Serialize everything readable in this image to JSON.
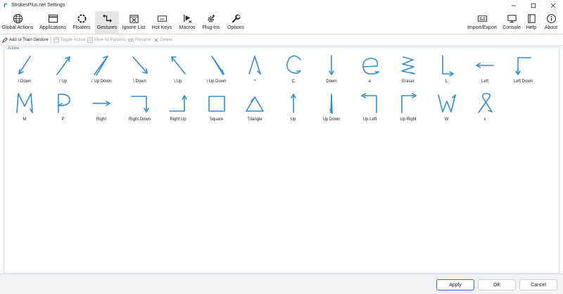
{
  "window": {
    "title": "StrokesPlus.net Settings"
  },
  "ribbon": [
    {
      "id": "global",
      "label": "Global Actions",
      "icon": "globe-icon"
    },
    {
      "id": "applications",
      "label": "Applications",
      "icon": "window-icon"
    },
    {
      "id": "floaters",
      "label": "Floaters",
      "icon": "floater-ring-icon"
    },
    {
      "id": "gestures",
      "label": "Gestures",
      "icon": "gesture-icon",
      "active": true
    },
    {
      "id": "ignore",
      "label": "Ignore List",
      "icon": "ignore-box-icon"
    },
    {
      "id": "hotkeys",
      "label": "Hot Keys",
      "icon": "keyboard-icon"
    },
    {
      "id": "macros",
      "label": "Macros",
      "icon": "macro-play-icon"
    },
    {
      "id": "plugins",
      "label": "Plug-ins",
      "icon": "plugin-gear-icon"
    },
    {
      "id": "options",
      "label": "Options",
      "icon": "wrench-icon"
    },
    {
      "id": "importexport",
      "label": "Import/Export",
      "icon": "import-export-icon"
    },
    {
      "id": "console",
      "label": "Console",
      "icon": "monitor-icon"
    },
    {
      "id": "help",
      "label": "Help",
      "icon": "help-book-icon"
    },
    {
      "id": "about",
      "label": "About",
      "icon": "info-icon"
    }
  ],
  "toolbar": {
    "add": "Add or Train Gesture",
    "toggle": "Toggle Active",
    "viewall": "View All Patterns",
    "rename": "Rename",
    "delete": "Delete"
  },
  "group": {
    "label": "Active"
  },
  "gestures": [
    {
      "label": "/ Down"
    },
    {
      "label": "/ Up"
    },
    {
      "label": "/ Up Down"
    },
    {
      "label": "\\ Down"
    },
    {
      "label": "\\ Up"
    },
    {
      "label": "\\ Up Down"
    },
    {
      "label": "^"
    },
    {
      "label": "C"
    },
    {
      "label": "Down"
    },
    {
      "label": "e"
    },
    {
      "label": "Eraser"
    },
    {
      "label": "L"
    },
    {
      "label": "Left"
    },
    {
      "label": "Left Down"
    },
    {
      "label": "M"
    },
    {
      "label": "P"
    },
    {
      "label": "Right"
    },
    {
      "label": "Right Down"
    },
    {
      "label": "Right Up"
    },
    {
      "label": "Square"
    },
    {
      "label": "Triangle"
    },
    {
      "label": "Up"
    },
    {
      "label": "Up Down"
    },
    {
      "label": "Up Left"
    },
    {
      "label": "Up Right"
    },
    {
      "label": "W"
    },
    {
      "label": "x"
    }
  ],
  "footer": {
    "apply": "Apply",
    "ok": "OK",
    "cancel": "Cancel"
  },
  "colors": {
    "stroke": "#2e8fd6",
    "accent": "#2d6fbf",
    "activeTab": "#e6e6e6"
  }
}
